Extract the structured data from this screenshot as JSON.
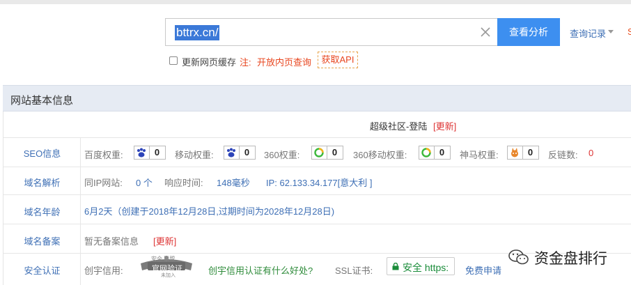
{
  "search": {
    "value": "bttrx.cn/",
    "button_label": "查看分析",
    "history_label": "查询记录",
    "edge_char": "S"
  },
  "options": {
    "refresh_cache_label": "更新网页缓存",
    "note_prefix": "注:",
    "note_link": "开放内页查询",
    "api_button": "获取API"
  },
  "panel": {
    "title": "网站基本信息",
    "site_title": "超级社区-登陆",
    "site_title_update": "[更新]",
    "rows": {
      "seo": {
        "label": "SEO信息",
        "baidu_label": "百度权重:",
        "baidu_value": "0",
        "mobile_label": "移动权重:",
        "mobile_value": "0",
        "s360_label": "360权重:",
        "s360_value": "0",
        "s360m_label": "360移动权重:",
        "s360m_value": "0",
        "shenma_label": "神马权重:",
        "shenma_value": "0",
        "backlinks_label": "反链数:",
        "backlinks_value": "0"
      },
      "dns": {
        "label": "域名解析",
        "same_ip_label": "同IP网站:",
        "same_ip_value": "0 个",
        "response_label": "响应时间:",
        "response_value": "148毫秒",
        "ip_text": "IP:  62.133.34.177[意大利 ]"
      },
      "age": {
        "label": "域名年龄",
        "value": "6月2天（创建于2018年12月28日,过期时间为2028年12月28日)"
      },
      "icp": {
        "label": "域名备案",
        "value": "暂无备案信息",
        "update": "[更新]"
      },
      "security": {
        "label": "安全认证",
        "credit_label": "创宇信用:",
        "badge_top": "安全 联盟",
        "badge_main": "官网验证",
        "badge_sub": "未加入",
        "credit_link": "创宇信用认证有什么好处?",
        "ssl_label": "SSL证书:",
        "ssl_badge": "安全 https:",
        "ssl_apply": "免费申请"
      }
    }
  },
  "watermark": {
    "text": "资金盘排行"
  },
  "colors": {
    "accent_blue": "#3d8ff0",
    "link_blue": "#3e6fb5",
    "orange": "#e8461f",
    "green": "#1a8c3a"
  }
}
